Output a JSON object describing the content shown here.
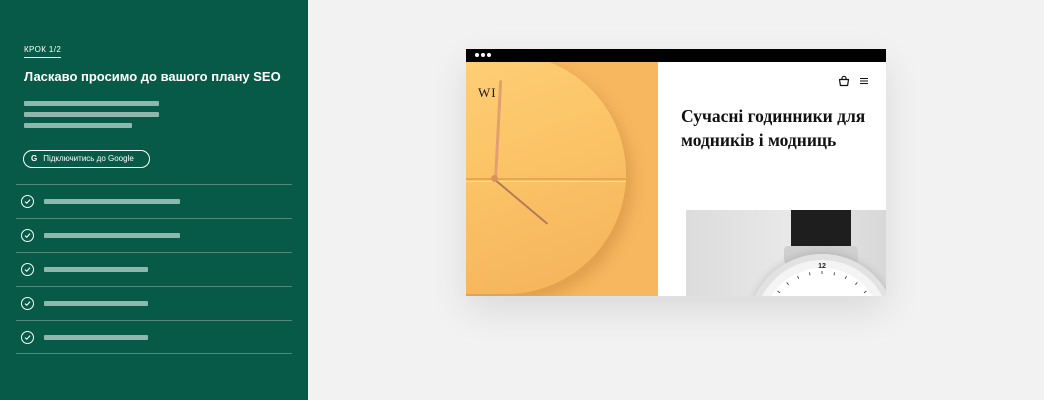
{
  "left_panel": {
    "step_label": "КРОК 1/2",
    "title": "Ласкаво просимо до вашого плану SEO",
    "google_button": {
      "icon_glyph": "G",
      "label": "Підключитись до Google"
    },
    "tasks": [
      {
        "status": "done"
      },
      {
        "status": "done"
      },
      {
        "status": "done"
      },
      {
        "status": "done"
      },
      {
        "status": "done"
      }
    ]
  },
  "preview": {
    "logo": "WI",
    "hero_heading": "Сучасні годинники для модників і модниць",
    "watch_dial_number": "12",
    "icons": [
      "cart-icon",
      "menu-icon"
    ]
  },
  "colors": {
    "panel_bg": "#075a47",
    "placeholder": "#8fb7ab",
    "clock_bg": "#f6b75f",
    "page_bg": "#f2f2f2",
    "titlebar": "#000000"
  }
}
